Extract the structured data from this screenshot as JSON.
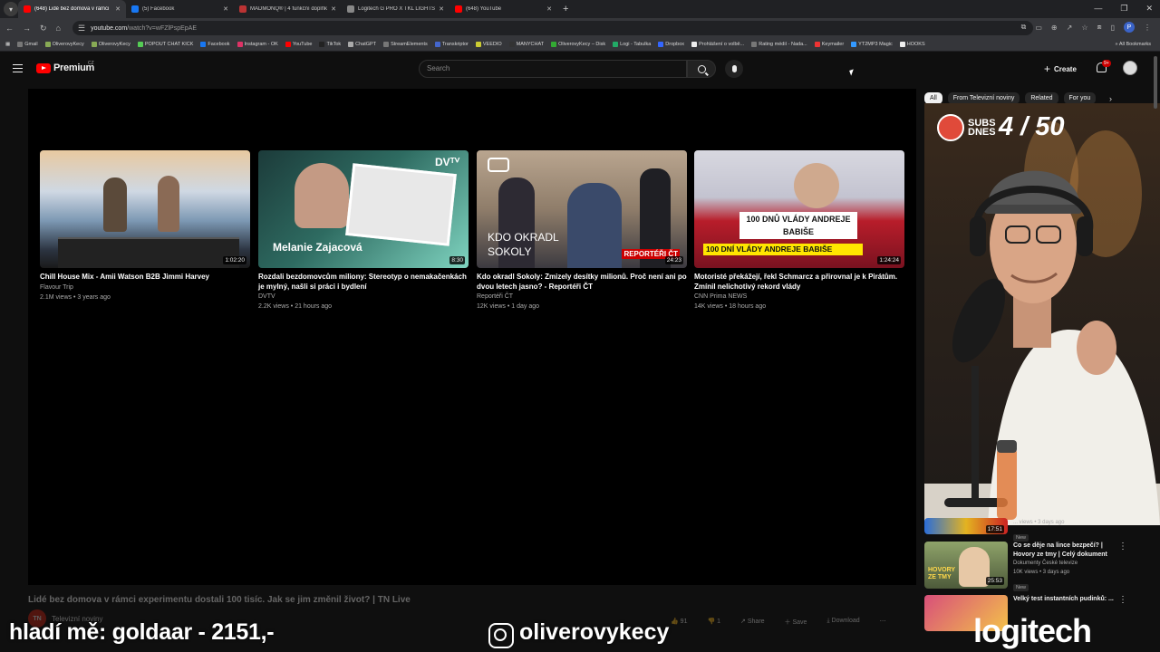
{
  "browser": {
    "tabs": [
      {
        "title": "(648) Lidé bez domova v rámci",
        "color": "#ff0000",
        "active": true
      },
      {
        "title": "(5) Facebook",
        "color": "#1877f2",
        "active": false
      },
      {
        "title": "MADMONQ® | 4 funkční doplňky",
        "color": "#b33",
        "active": false
      },
      {
        "title": "Logitech G PRO X TKL LIGHTSPEED",
        "color": "#888",
        "active": false
      },
      {
        "title": "(648) YouTube",
        "color": "#ff0000",
        "active": false
      }
    ],
    "url": "youtube.com",
    "url_path": "/watch?v=wFZlPspEpAE",
    "profile_letter": "P",
    "bookmarks": [
      "Gmail",
      "OliverovyKecy",
      "OliverovyKecy",
      "POPOUT CHAT KICK",
      "Facebook",
      "Instagram - OK",
      "YouTube",
      "TikTok",
      "ChatGPT",
      "StreamElements",
      "Transkriptor",
      "VEEDIO",
      "MANYCHAT",
      "OliverovyKecy – Disk",
      "Logi - Tabulka",
      "Dropbox",
      "Prohlášení o volbě...",
      "Rating médií - Nada...",
      "Keymailer",
      "YT2MP3 Magic",
      "HOOKS"
    ],
    "all_bookmarks": "All Bookmarks"
  },
  "youtube": {
    "logo": "Premium",
    "country": "CZ",
    "search_placeholder": "Search",
    "create_label": "Create",
    "notifications": "9+"
  },
  "endscreen": [
    {
      "title": "Chill House Mix - Amii Watson B2B Jimmi Harvey",
      "channel": "Flavour Trip",
      "meta": "2.1M views • 3 years ago",
      "duration": "1:02:20"
    },
    {
      "title": "Rozdali bezdomovcům miliony: Stereotyp o nemakačenkách je mylný, našli si práci i bydlení",
      "channel": "DVTV",
      "meta": "2.2K views • 21 hours ago",
      "duration": "8:30",
      "overlay": "Melanie Zajacová",
      "brand": "DVᵀⱽ"
    },
    {
      "title": "Kdo okradl Sokoly: Zmizely desítky milionů. Proč není ani po dvou letech jasno? - Reportéři ČT",
      "channel": "Reportéři ČT",
      "meta": "12K views • 1 day ago",
      "duration": "24:23",
      "overlay": "KDO OKRADL SOKOLY",
      "brand": "REPORTÉŘI ČT"
    },
    {
      "title": "Motoristé překážejí, řekl Schmarcz a přirovnal je k Pirátům. Zmínil nelichotivý rekord vlády",
      "channel": "CNN Prima NEWS",
      "meta": "14K views • 18 hours ago",
      "duration": "1:24:24",
      "overlay": "100 DNŮ VLÁDY ANDREJE BABIŠE",
      "banner": "100 DNÍ VLÁDY ANDREJE BABIŠE"
    }
  ],
  "video": {
    "title": "Lidé bez domova v rámci experimentu dostali 100 tisíc. Jak se jim změnil život? | TN Live",
    "channel": "Televizní noviny",
    "channel_initials": "TN",
    "likes": "91",
    "dislikes": "1",
    "share": "Share",
    "save": "Save",
    "download": "Download"
  },
  "sidebar": {
    "chips": [
      "All",
      "From Televizní noviny",
      "Related",
      "For you"
    ],
    "subs_label": "SUBS DNES",
    "subs_value": "4 / 50",
    "items": [
      {
        "title": "",
        "channel": "",
        "meta": "... views • 3 days ago",
        "duration": "17:51",
        "badge": "New"
      },
      {
        "title": "Co se děje na lince bezpečí? | Hovory ze tmy | Celý dokument",
        "channel": "Dokumenty České televize",
        "meta": "10K views • 3 days ago",
        "duration": "25:53",
        "badge": "New",
        "thumb_text": "HOVORY ZE TMY"
      },
      {
        "title": "Velký test instantních pudinků: ...",
        "channel": "",
        "meta": "",
        "duration": "",
        "badge": ""
      }
    ]
  },
  "overlays": {
    "donation": "hladí mě: goldaar - 2151,-",
    "instagram": "oliverovykecy",
    "sponsor": "logitech"
  }
}
